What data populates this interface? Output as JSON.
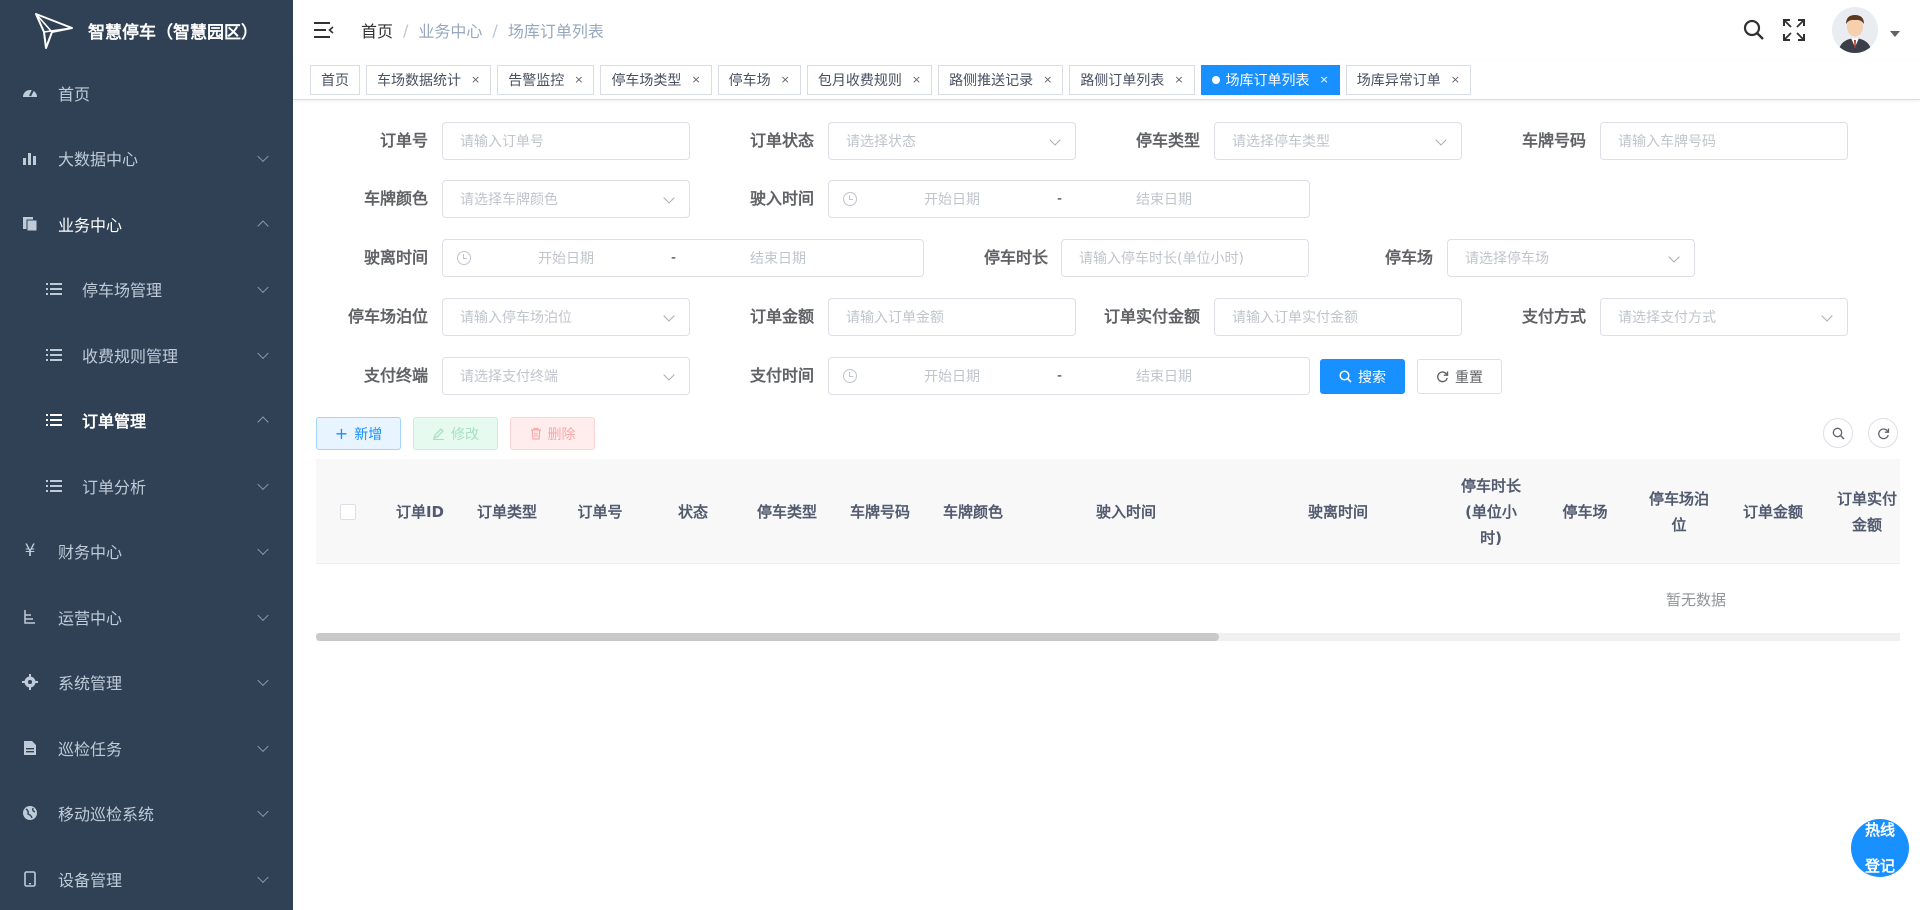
{
  "app": {
    "title": "智慧停车（智慧园区）"
  },
  "sidebar": {
    "items": [
      {
        "label": "首页",
        "icon": "dashboard-icon"
      },
      {
        "label": "大数据中心",
        "icon": "bar-chart-icon"
      },
      {
        "label": "业务中心",
        "icon": "documents-icon"
      },
      {
        "label": "停车场管理",
        "icon": "list-icon"
      },
      {
        "label": "收费规则管理",
        "icon": "list-icon"
      },
      {
        "label": "订单管理",
        "icon": "list-icon"
      },
      {
        "label": "订单分析",
        "icon": "list-icon"
      },
      {
        "label": "财务中心",
        "icon": "yen-icon"
      },
      {
        "label": "运营中心",
        "icon": "tree-icon"
      },
      {
        "label": "系统管理",
        "icon": "gear-icon"
      },
      {
        "label": "巡检任务",
        "icon": "document-icon"
      },
      {
        "label": "移动巡检系统",
        "icon": "globe-icon"
      },
      {
        "label": "设备管理",
        "icon": "phone-icon"
      }
    ]
  },
  "breadcrumb": {
    "home": "首页",
    "sep": "/",
    "level2": "业务中心",
    "level3": "场库订单列表"
  },
  "tags": [
    {
      "label": "首页"
    },
    {
      "label": "车场数据统计"
    },
    {
      "label": "告警监控"
    },
    {
      "label": "停车场类型"
    },
    {
      "label": "停车场"
    },
    {
      "label": "包月收费规则"
    },
    {
      "label": "路侧推送记录"
    },
    {
      "label": "路侧订单列表"
    },
    {
      "label": "场库订单列表"
    },
    {
      "label": "场库异常订单"
    }
  ],
  "tag_close": "×",
  "filters": {
    "order_no": {
      "label": "订单号",
      "placeholder": "请输入订单号"
    },
    "order_status": {
      "label": "订单状态",
      "placeholder": "请选择状态"
    },
    "parking_type": {
      "label": "停车类型",
      "placeholder": "请选择停车类型"
    },
    "plate_no": {
      "label": "车牌号码",
      "placeholder": "请输入车牌号码"
    },
    "plate_color": {
      "label": "车牌颜色",
      "placeholder": "请选择车牌颜色"
    },
    "entry_time": {
      "label": "驶入时间",
      "start": "开始日期",
      "sep": "-",
      "end": "结束日期"
    },
    "exit_time": {
      "label": "驶离时间",
      "start": "开始日期",
      "sep": "-",
      "end": "结束日期"
    },
    "duration": {
      "label": "停车时长",
      "placeholder": "请输入停车时长(单位小时)"
    },
    "parking_lot": {
      "label": "停车场",
      "placeholder": "请选择停车场"
    },
    "berth": {
      "label": "停车场泊位",
      "placeholder": "请输入停车场泊位"
    },
    "order_amount": {
      "label": "订单金额",
      "placeholder": "请输入订单金额"
    },
    "paid_amount": {
      "label": "订单实付金额",
      "placeholder": "请输入订单实付金额"
    },
    "pay_method": {
      "label": "支付方式",
      "placeholder": "请选择支付方式"
    },
    "pay_terminal": {
      "label": "支付终端",
      "placeholder": "请选择支付终端"
    },
    "pay_time": {
      "label": "支付时间",
      "start": "开始日期",
      "sep": "-",
      "end": "结束日期"
    }
  },
  "buttons": {
    "search": "搜索",
    "reset": "重置",
    "add": "新增",
    "edit": "修改",
    "delete": "删除"
  },
  "table": {
    "columns": [
      "订单ID",
      "订单类型",
      "订单号",
      "状态",
      "停车类型",
      "车牌号码",
      "车牌颜色",
      "驶入时间",
      "驶离时间",
      "停车时长(单位小时)",
      "停车场",
      "停车场泊位",
      "订单金额",
      "订单实付金额"
    ],
    "column_lines": {
      "duration": [
        "停车时长",
        "(单位小",
        "时)"
      ],
      "berth": [
        "停车场泊",
        "位"
      ],
      "paid": [
        "订单实付",
        "金额"
      ]
    },
    "empty_text": "暂无数据",
    "scroll_fraction": 0.57
  },
  "hotline": {
    "line1": "热线",
    "line2": "登记"
  },
  "colors": {
    "sidebar_bg": "#304156",
    "primary": "#1890ff",
    "success_light": "#e7faf0",
    "danger_light": "#ffeded"
  }
}
